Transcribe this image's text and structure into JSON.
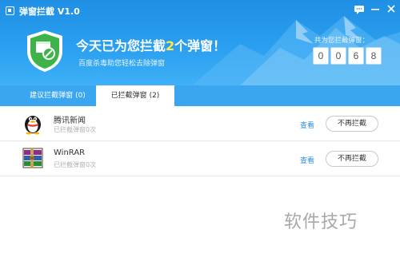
{
  "window": {
    "title": "弹窗拦截 V1.0",
    "feedback_icon": "chat-bubble-icon",
    "minimize_icon": "minimize-icon",
    "close_icon": "close-icon"
  },
  "header": {
    "headline_prefix": "今天已为您拦截",
    "headline_count": "2",
    "headline_suffix": "个弹窗！",
    "subline": "百度杀毒助您轻松去除弹窗",
    "counter_label": "共为您拦截弹窗：",
    "counter_digits": [
      "0",
      "0",
      "6",
      "8"
    ],
    "shield_icon": "shield-block-icon",
    "accent_color": "#2a9ff0",
    "highlight_color": "#ffe84a"
  },
  "tabs": [
    {
      "label": "建议拦截弹窗",
      "count": "(0)",
      "active": false
    },
    {
      "label": "已拦截弹窗",
      "count": "(2)",
      "active": true
    }
  ],
  "items": [
    {
      "name": "腾讯新闻",
      "stat": "已拦截弹窗0次",
      "view_label": "查看",
      "action_label": "不再拦截",
      "icon": "qq-penguin-icon"
    },
    {
      "name": "WinRAR",
      "stat": "已拦截弹窗0次",
      "view_label": "查看",
      "action_label": "不再拦截",
      "icon": "winrar-books-icon"
    }
  ],
  "watermark": "软件技巧"
}
